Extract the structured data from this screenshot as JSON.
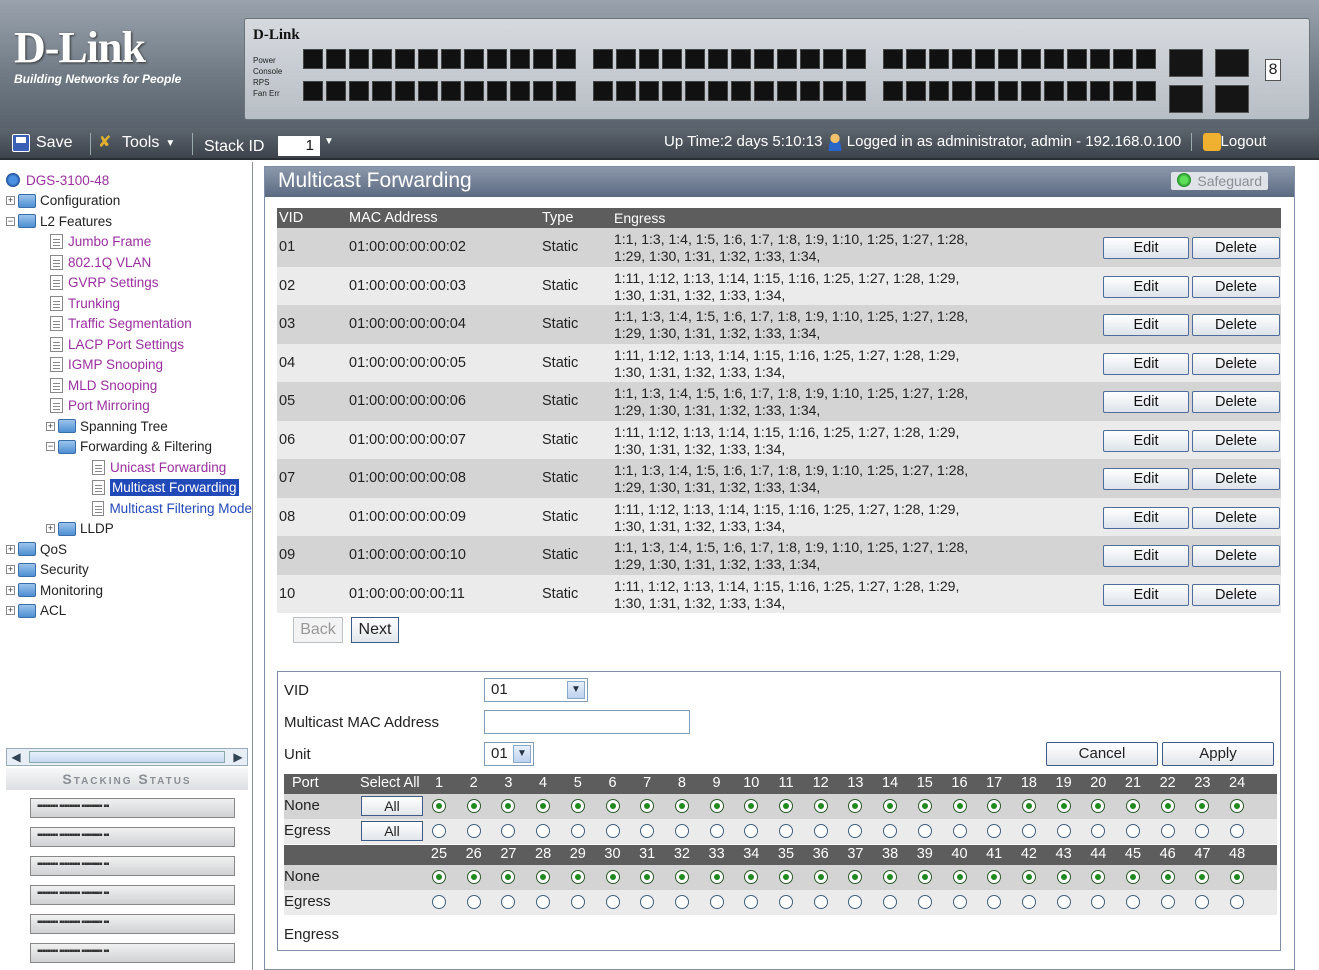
{
  "banner": {
    "logo_brand": "D-Link",
    "logo_tagline": "Building Networks for People",
    "chassis_brand": "D-Link",
    "leds": [
      "Power",
      "Console",
      "RPS",
      "Fan Err"
    ],
    "seven_segment": "8"
  },
  "toolbar": {
    "save_label": "Save",
    "tools_label": "Tools",
    "stack_id_label": "Stack ID",
    "stack_id_value": "1",
    "uptime": "Up Time:2 days 5:10:13",
    "login_text": "Logged in as administrator, admin - 192.168.0.100",
    "logout_label": "Logout"
  },
  "tree": {
    "root": "DGS-3100-48",
    "configuration": "Configuration",
    "l2_features": "L2 Features",
    "l2_items": [
      "Jumbo Frame",
      "802.1Q VLAN",
      "GVRP Settings",
      "Trunking",
      "Traffic Segmentation",
      "LACP Port Settings",
      "IGMP Snooping",
      "MLD Snooping",
      "Port Mirroring"
    ],
    "spanning_tree": "Spanning Tree",
    "fwd_filtering": "Forwarding & Filtering",
    "fwd_items": [
      "Unicast Forwarding",
      "Multicast Forwarding",
      "Multicast Filtering Mode"
    ],
    "lldp": "LLDP",
    "qos": "QoS",
    "security": "Security",
    "monitoring": "Monitoring",
    "acl": "ACL"
  },
  "stacking": {
    "header": "Stacking Status"
  },
  "main": {
    "title": "Multicast Forwarding",
    "safeguard": "Safeguard",
    "columns": [
      "VID",
      "MAC Address",
      "Type",
      "Engress"
    ],
    "edit_label": "Edit",
    "delete_label": "Delete",
    "rows": [
      {
        "vid": "01",
        "mac": "01:00:00:00:00:02",
        "type": "Static",
        "eg1": "1:1, 1:3, 1:4, 1:5, 1:6, 1:7, 1:8, 1:9, 1:10, 1:25, 1:27, 1:28,",
        "eg2": "1:29, 1:30, 1:31, 1:32, 1:33, 1:34,"
      },
      {
        "vid": "02",
        "mac": "01:00:00:00:00:03",
        "type": "Static",
        "eg1": "1:11, 1:12, 1:13, 1:14, 1:15, 1:16, 1:25, 1:27, 1:28, 1:29,",
        "eg2": "1:30, 1:31, 1:32, 1:33, 1:34,"
      },
      {
        "vid": "03",
        "mac": "01:00:00:00:00:04",
        "type": "Static",
        "eg1": "1:1, 1:3, 1:4, 1:5, 1:6, 1:7, 1:8, 1:9, 1:10, 1:25, 1:27, 1:28,",
        "eg2": "1:29, 1:30, 1:31, 1:32, 1:33, 1:34,"
      },
      {
        "vid": "04",
        "mac": "01:00:00:00:00:05",
        "type": "Static",
        "eg1": "1:11, 1:12, 1:13, 1:14, 1:15, 1:16, 1:25, 1:27, 1:28, 1:29,",
        "eg2": "1:30, 1:31, 1:32, 1:33, 1:34,"
      },
      {
        "vid": "05",
        "mac": "01:00:00:00:00:06",
        "type": "Static",
        "eg1": "1:1, 1:3, 1:4, 1:5, 1:6, 1:7, 1:8, 1:9, 1:10, 1:25, 1:27, 1:28,",
        "eg2": "1:29, 1:30, 1:31, 1:32, 1:33, 1:34,"
      },
      {
        "vid": "06",
        "mac": "01:00:00:00:00:07",
        "type": "Static",
        "eg1": "1:11, 1:12, 1:13, 1:14, 1:15, 1:16, 1:25, 1:27, 1:28, 1:29,",
        "eg2": "1:30, 1:31, 1:32, 1:33, 1:34,"
      },
      {
        "vid": "07",
        "mac": "01:00:00:00:00:08",
        "type": "Static",
        "eg1": "1:1, 1:3, 1:4, 1:5, 1:6, 1:7, 1:8, 1:9, 1:10, 1:25, 1:27, 1:28,",
        "eg2": "1:29, 1:30, 1:31, 1:32, 1:33, 1:34,"
      },
      {
        "vid": "08",
        "mac": "01:00:00:00:00:09",
        "type": "Static",
        "eg1": "1:11, 1:12, 1:13, 1:14, 1:15, 1:16, 1:25, 1:27, 1:28, 1:29,",
        "eg2": "1:30, 1:31, 1:32, 1:33, 1:34,"
      },
      {
        "vid": "09",
        "mac": "01:00:00:00:00:10",
        "type": "Static",
        "eg1": "1:1, 1:3, 1:4, 1:5, 1:6, 1:7, 1:8, 1:9, 1:10, 1:25, 1:27, 1:28,",
        "eg2": "1:29, 1:30, 1:31, 1:32, 1:33, 1:34,"
      },
      {
        "vid": "10",
        "mac": "01:00:00:00:00:11",
        "type": "Static",
        "eg1": "1:11, 1:12, 1:13, 1:14, 1:15, 1:16, 1:25, 1:27, 1:28, 1:29,",
        "eg2": "1:30, 1:31, 1:32, 1:33, 1:34,"
      }
    ],
    "back_label": "Back",
    "next_label": "Next"
  },
  "form": {
    "vid_label": "VID",
    "vid_value": "01",
    "mac_label": "Multicast MAC Address",
    "mac_value": "",
    "unit_label": "Unit",
    "unit_value": "01",
    "cancel_label": "Cancel",
    "apply_label": "Apply",
    "port_label": "Port",
    "select_all_label": "Select All",
    "none_label": "None",
    "egress_label": "Egress",
    "all_label": "All",
    "ports_row1": [
      "1",
      "2",
      "3",
      "4",
      "5",
      "6",
      "7",
      "8",
      "9",
      "10",
      "11",
      "12",
      "13",
      "14",
      "15",
      "16",
      "17",
      "18",
      "19",
      "20",
      "21",
      "22",
      "23",
      "24"
    ],
    "ports_row2": [
      "25",
      "26",
      "27",
      "28",
      "29",
      "30",
      "31",
      "32",
      "33",
      "34",
      "35",
      "36",
      "37",
      "38",
      "39",
      "40",
      "41",
      "42",
      "43",
      "44",
      "45",
      "46",
      "47",
      "48"
    ],
    "selected_mode": "None",
    "engress_footer": "Engress"
  }
}
